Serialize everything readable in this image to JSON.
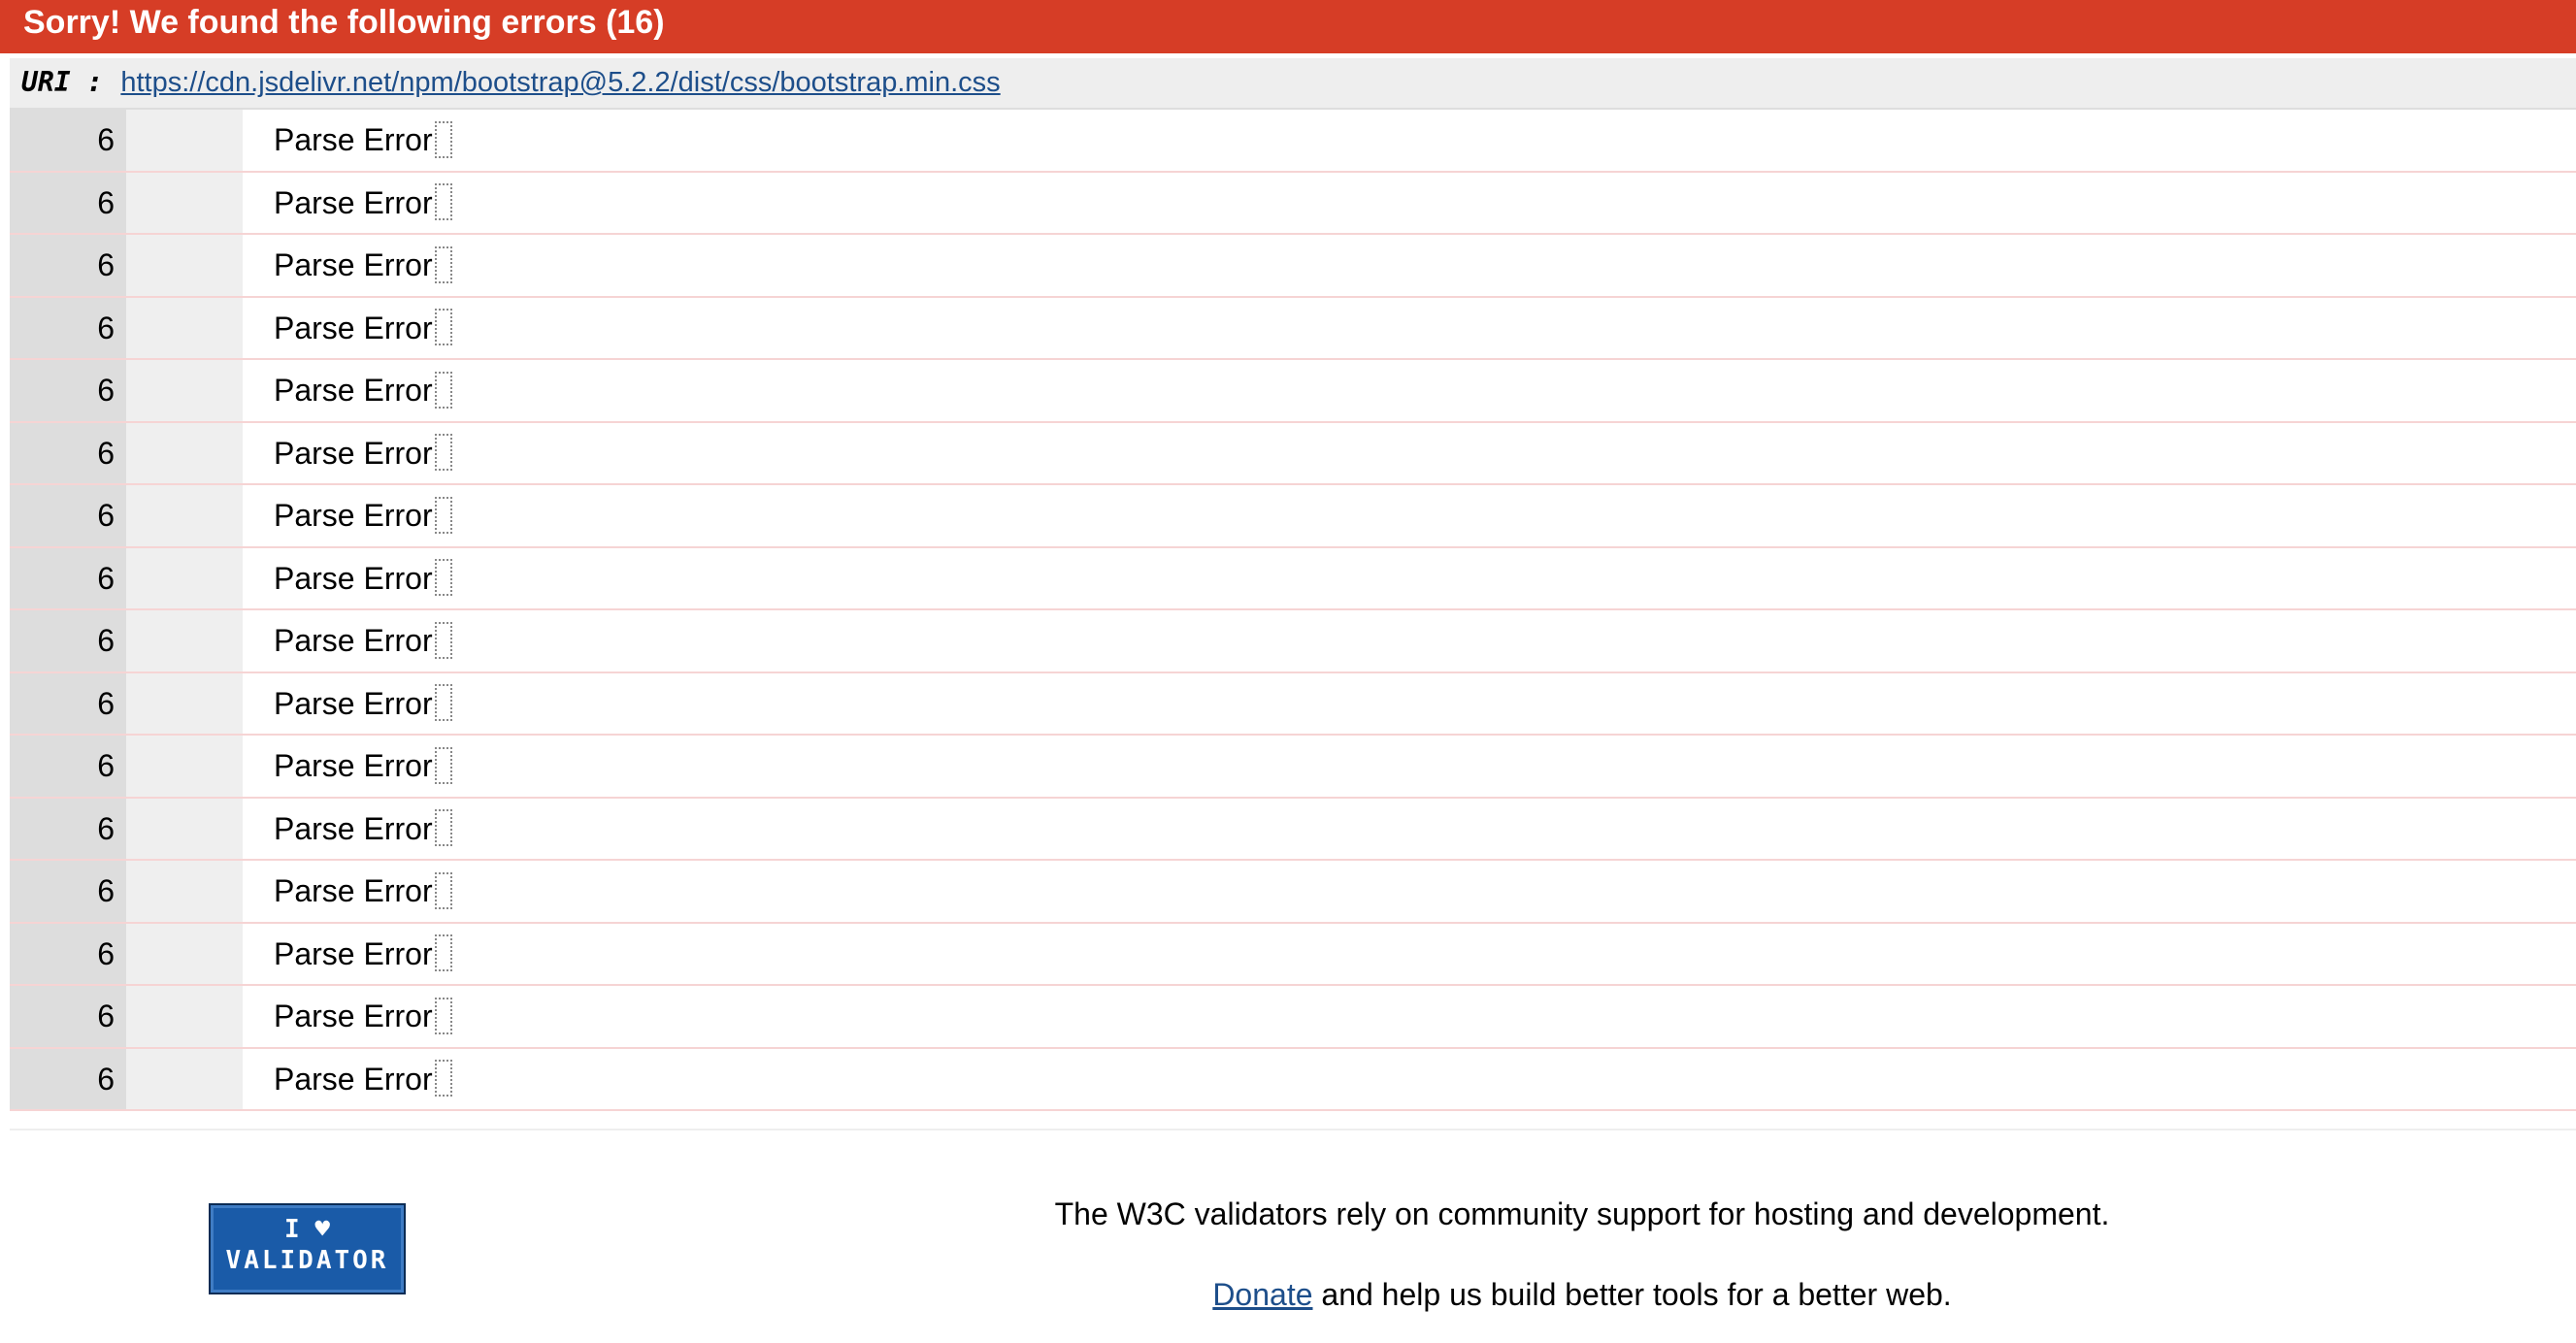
{
  "header": {
    "title": "Sorry! We found the following errors (16)"
  },
  "uri": {
    "label": "URI :",
    "url": "https://cdn.jsdelivr.net/npm/bootstrap@5.2.2/dist/css/bootstrap.min.css"
  },
  "errors": [
    {
      "line": "6",
      "context": "",
      "message": "Parse Error"
    },
    {
      "line": "6",
      "context": "",
      "message": "Parse Error"
    },
    {
      "line": "6",
      "context": "",
      "message": "Parse Error"
    },
    {
      "line": "6",
      "context": "",
      "message": "Parse Error"
    },
    {
      "line": "6",
      "context": "",
      "message": "Parse Error"
    },
    {
      "line": "6",
      "context": "",
      "message": "Parse Error"
    },
    {
      "line": "6",
      "context": "",
      "message": "Parse Error"
    },
    {
      "line": "6",
      "context": "",
      "message": "Parse Error"
    },
    {
      "line": "6",
      "context": "",
      "message": "Parse Error"
    },
    {
      "line": "6",
      "context": "",
      "message": "Parse Error"
    },
    {
      "line": "6",
      "context": "",
      "message": "Parse Error"
    },
    {
      "line": "6",
      "context": "",
      "message": "Parse Error"
    },
    {
      "line": "6",
      "context": "",
      "message": "Parse Error"
    },
    {
      "line": "6",
      "context": "",
      "message": "Parse Error"
    },
    {
      "line": "6",
      "context": "",
      "message": "Parse Error"
    },
    {
      "line": "6",
      "context": "",
      "message": "Parse Error"
    }
  ],
  "footer": {
    "badge": {
      "line1": "I ♥",
      "line2": "VALIDATOR",
      "icon": "heart-icon"
    },
    "support_text": "The W3C validators rely on community support for hosting and development.",
    "donate_link": "Donate",
    "donate_rest": " and help us build better tools for a better web."
  },
  "colors": {
    "header_bg": "#d63d26",
    "link": "#1d4e8a",
    "badge_bg": "#1a5ba8",
    "row_divider": "#f6d4d4"
  }
}
